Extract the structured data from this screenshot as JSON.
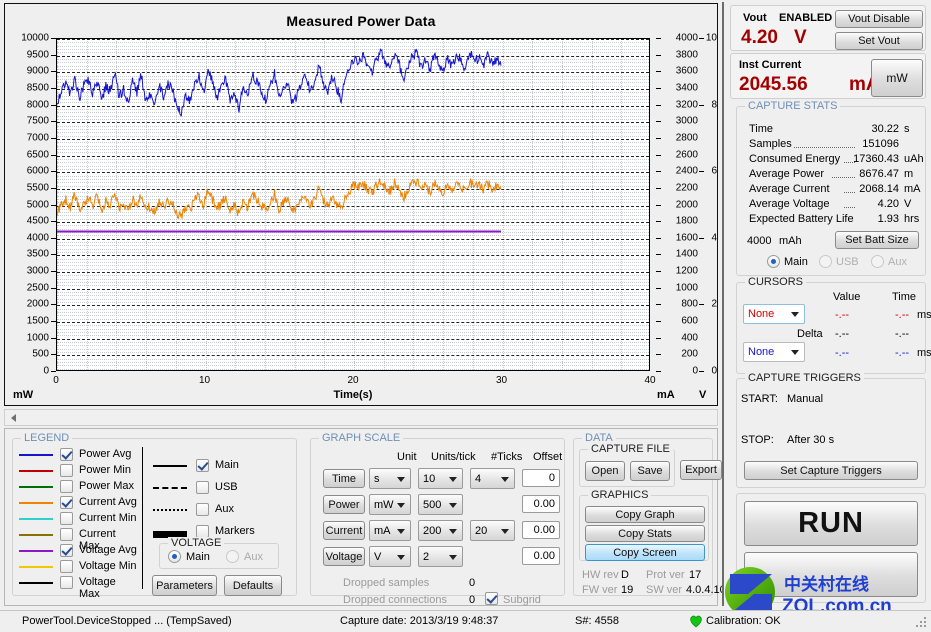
{
  "chart_data": {
    "type": "line",
    "title": "Measured Power Data",
    "xlabel": "Time(s)",
    "xlim": [
      0,
      40
    ],
    "xticks": [
      0,
      10,
      20,
      30,
      40
    ],
    "grid": true,
    "subgrid": true,
    "axes": [
      {
        "name": "Power",
        "unit": "mW",
        "side": "left",
        "lim": [
          0,
          10000
        ],
        "tick_step": 500,
        "ticks": [
          0,
          500,
          1000,
          1500,
          2000,
          2500,
          3000,
          3500,
          4000,
          4500,
          5000,
          5500,
          6000,
          6500,
          7000,
          7500,
          8000,
          8500,
          9000,
          9500,
          10000
        ]
      },
      {
        "name": "Current",
        "unit": "mA",
        "side": "right",
        "lim": [
          0,
          4000
        ],
        "tick_step": 200,
        "ticks": [
          0,
          200,
          400,
          600,
          800,
          1000,
          1200,
          1400,
          1600,
          1800,
          2000,
          2200,
          2400,
          2600,
          2800,
          3000,
          3200,
          3400,
          3600,
          3800,
          4000
        ]
      },
      {
        "name": "Voltage",
        "unit": "V",
        "side": "right2",
        "lim": [
          0,
          10
        ],
        "tick_step": 2,
        "ticks": [
          0,
          2,
          4,
          6,
          8,
          10
        ]
      }
    ],
    "series": [
      {
        "name": "Power Avg",
        "color": "#1515cf",
        "axis": "Power",
        "unit": "mW",
        "x": [
          0.0,
          0.3,
          0.6,
          0.9,
          1.2,
          1.5,
          1.8,
          2.1,
          2.4,
          2.7,
          3.0,
          3.3,
          3.6,
          3.9,
          4.2,
          4.5,
          4.8,
          5.1,
          5.4,
          5.7,
          6.0,
          6.3,
          6.6,
          6.9,
          7.2,
          7.5,
          7.8,
          8.1,
          8.4,
          8.7,
          9.0,
          9.3,
          9.6,
          9.9,
          10.2,
          10.5,
          10.8,
          11.1,
          11.4,
          11.7,
          12.0,
          12.3,
          12.6,
          12.9,
          13.2,
          13.5,
          13.8,
          14.1,
          14.4,
          14.7,
          15.0,
          15.3,
          15.6,
          15.9,
          16.2,
          16.5,
          16.8,
          17.1,
          17.4,
          17.7,
          18.0,
          18.3,
          18.6,
          18.9,
          19.2,
          19.5,
          19.8,
          20.1,
          20.4,
          20.7,
          21.0,
          21.3,
          21.6,
          21.9,
          22.2,
          22.5,
          22.8,
          23.1,
          23.4,
          23.7,
          24.0,
          24.3,
          24.6,
          24.9,
          25.2,
          25.5,
          25.8,
          26.1,
          26.4,
          26.7,
          27.0,
          27.3,
          27.6,
          27.9,
          28.2,
          28.5,
          28.8,
          29.1,
          29.4,
          29.7,
          30.0
        ],
        "y": [
          8000,
          8450,
          8700,
          8300,
          8900,
          8200,
          8550,
          8750,
          8350,
          8800,
          8150,
          8600,
          8400,
          9000,
          8250,
          8500,
          8050,
          8700,
          8400,
          8900,
          8100,
          8350,
          7950,
          8600,
          8250,
          8700,
          8450,
          8000,
          7800,
          8300,
          8150,
          8600,
          8900,
          8400,
          9100,
          8700,
          8250,
          8500,
          8800,
          8100,
          8350,
          7900,
          8600,
          8250,
          9000,
          8700,
          8400,
          8150,
          8550,
          8950,
          8200,
          8500,
          8750,
          8050,
          8300,
          8650,
          8900,
          8450,
          8700,
          9200,
          8600,
          8300,
          8900,
          8500,
          8200,
          8850,
          9150,
          9400,
          9300,
          9500,
          9200,
          9000,
          9400,
          9600,
          9250,
          9100,
          9500,
          9300,
          8700,
          9200,
          9450,
          9600,
          9150,
          9350,
          9050,
          9550,
          9250,
          9000,
          9400,
          9200,
          9550,
          9350,
          9100,
          9600,
          9300,
          9450,
          9150,
          9500,
          9250,
          9400,
          9200
        ]
      },
      {
        "name": "Current Avg",
        "color": "#ef8200",
        "axis": "Current",
        "unit": "mA",
        "x": [
          0.0,
          0.3,
          0.6,
          0.9,
          1.2,
          1.5,
          1.8,
          2.1,
          2.4,
          2.7,
          3.0,
          3.3,
          3.6,
          3.9,
          4.2,
          4.5,
          4.8,
          5.1,
          5.4,
          5.7,
          6.0,
          6.3,
          6.6,
          6.9,
          7.2,
          7.5,
          7.8,
          8.1,
          8.4,
          8.7,
          9.0,
          9.3,
          9.6,
          9.9,
          10.2,
          10.5,
          10.8,
          11.1,
          11.4,
          11.7,
          12.0,
          12.3,
          12.6,
          12.9,
          13.2,
          13.5,
          13.8,
          14.1,
          14.4,
          14.7,
          15.0,
          15.3,
          15.6,
          15.9,
          16.2,
          16.5,
          16.8,
          17.1,
          17.4,
          17.7,
          18.0,
          18.3,
          18.6,
          18.9,
          19.2,
          19.5,
          19.8,
          20.1,
          20.4,
          20.7,
          21.0,
          21.3,
          21.6,
          21.9,
          22.2,
          22.5,
          22.8,
          23.1,
          23.4,
          23.7,
          24.0,
          24.3,
          24.6,
          24.9,
          25.2,
          25.5,
          25.8,
          26.1,
          26.4,
          26.7,
          27.0,
          27.3,
          27.6,
          27.9,
          28.2,
          28.5,
          28.8,
          29.1,
          29.4,
          29.7,
          30.0
        ],
        "y": [
          1900,
          2010,
          2070,
          1980,
          2120,
          1960,
          2030,
          2080,
          1990,
          2100,
          1940,
          2050,
          2000,
          2140,
          1970,
          2020,
          1910,
          2070,
          2000,
          2120,
          1930,
          1990,
          1890,
          2050,
          1970,
          2070,
          2010,
          1900,
          1860,
          1980,
          1940,
          2050,
          2120,
          2000,
          2170,
          2070,
          1970,
          2020,
          2100,
          1930,
          1990,
          1880,
          2050,
          1970,
          2140,
          2070,
          2000,
          1940,
          2030,
          2130,
          1950,
          2020,
          2080,
          1910,
          1980,
          2060,
          2120,
          2010,
          2070,
          2190,
          2050,
          1980,
          2120,
          2020,
          1950,
          2110,
          2180,
          2240,
          2210,
          2260,
          2190,
          2150,
          2240,
          2290,
          2200,
          2170,
          2260,
          2220,
          2070,
          2190,
          2250,
          2290,
          2180,
          2230,
          2160,
          2270,
          2200,
          2140,
          2240,
          2190,
          2270,
          2230,
          2170,
          2290,
          2210,
          2250,
          2180,
          2260,
          2200,
          2240,
          2190
        ]
      },
      {
        "name": "Voltage Avg",
        "color": "#8b18c9",
        "axis": "Voltage",
        "unit": "V",
        "x": [
          0,
          30
        ],
        "y": [
          4.2,
          4.2
        ]
      }
    ]
  },
  "legend": {
    "title": "LEGEND",
    "items": [
      {
        "label": "Power Avg",
        "color": "#1515cf",
        "checked": true
      },
      {
        "label": "Power Min",
        "color": "#c00000",
        "checked": false
      },
      {
        "label": "Power Max",
        "color": "#007000",
        "checked": false
      },
      {
        "label": "Current Avg",
        "color": "#ef8200",
        "checked": true
      },
      {
        "label": "Current Min",
        "color": "#2bd0d0",
        "checked": false
      },
      {
        "label": "Current Max",
        "color": "#8a7000",
        "checked": false
      },
      {
        "label": "Voltage Avg",
        "color": "#8b18c9",
        "checked": true
      },
      {
        "label": "Voltage Min",
        "color": "#f2c600",
        "checked": false
      },
      {
        "label": "Voltage Max",
        "color": "#000000",
        "checked": false
      }
    ],
    "channels": [
      {
        "label": "Main",
        "style": "solid",
        "checked": true
      },
      {
        "label": "USB",
        "style": "dashed",
        "checked": false
      },
      {
        "label": "Aux",
        "style": "dotted",
        "checked": false
      },
      {
        "label": "Markers",
        "style": "thick",
        "checked": false
      }
    ],
    "voltage_group": {
      "title": "VOLTAGE",
      "options": [
        {
          "label": "Main",
          "selected": true,
          "enabled": true
        },
        {
          "label": "Aux",
          "selected": false,
          "enabled": false
        }
      ]
    },
    "parameters_button": "Parameters",
    "defaults_button": "Defaults"
  },
  "graph_scale": {
    "title": "GRAPH SCALE",
    "headers": {
      "unit": "Unit",
      "units_per_tick": "Units/tick",
      "ticks": "#Ticks",
      "offset": "Offset"
    },
    "rows": [
      {
        "name": "Time",
        "unit": "s",
        "units_per_tick": "10",
        "ticks": "4",
        "offset": "0",
        "has_ticks": true
      },
      {
        "name": "Power",
        "unit": "mW",
        "units_per_tick": "500",
        "ticks": "",
        "offset": "0.00",
        "has_ticks": false
      },
      {
        "name": "Current",
        "unit": "mA",
        "units_per_tick": "200",
        "ticks": "20",
        "offset": "0.00",
        "has_ticks": true
      },
      {
        "name": "Voltage",
        "unit": "V",
        "units_per_tick": "2",
        "ticks": "",
        "offset": "0.00",
        "has_ticks": false
      }
    ],
    "dropped_samples_label": "Dropped samples",
    "dropped_samples_value": "0",
    "dropped_connections_label": "Dropped connections",
    "dropped_connections_value": "0",
    "subgrid_label": "Subgrid",
    "subgrid_checked": true
  },
  "data_panel": {
    "title": "DATA",
    "capture_file_title": "CAPTURE FILE",
    "open_button": "Open",
    "save_button": "Save",
    "export_button": "Export",
    "graphics_title": "GRAPHICS",
    "copy_graph_button": "Copy Graph",
    "copy_stats_button": "Copy Stats",
    "copy_screen_button": "Copy Screen",
    "hw_rev_label": "HW rev",
    "hw_rev_value": "D",
    "prot_ver_label": "Prot ver",
    "prot_ver_value": "17",
    "fw_ver_label": "FW ver",
    "fw_ver_value": "19",
    "sw_ver_label": "SW ver",
    "sw_ver_value": "4.0.4.10"
  },
  "vout": {
    "label": "Vout",
    "state": "ENABLED",
    "value": "4.20",
    "unit": "V",
    "disable_button": "Vout Disable",
    "set_button": "Set Vout"
  },
  "inst_current": {
    "label": "Inst Current",
    "value": "2045.56",
    "unit": "mA",
    "mode_button": "mW"
  },
  "capture_stats": {
    "title": "CAPTURE STATS",
    "rows": [
      {
        "label": "Time",
        "value": "30.22",
        "unit": "s",
        "leader": false
      },
      {
        "label": "Samples",
        "value": "151096",
        "unit": "",
        "leader": true
      },
      {
        "label": "Consumed Energy",
        "value": "17360.43",
        "unit": "uAh",
        "leader": true
      },
      {
        "label": "Average Power",
        "value": "8676.47",
        "unit": "m",
        "leader": true
      },
      {
        "label": "Average Current",
        "value": "2068.14",
        "unit": "mA",
        "leader": true
      },
      {
        "label": "Average Voltage",
        "value": "4.20",
        "unit": "V",
        "leader": true
      },
      {
        "label": "Expected Battery Life",
        "value": "1.93",
        "unit": "hrs",
        "leader": false
      }
    ],
    "batt_size_value": "4000",
    "batt_size_unit": "mAh",
    "set_batt_button": "Set Batt Size",
    "sources": [
      {
        "label": "Main",
        "selected": true,
        "enabled": true
      },
      {
        "label": "USB",
        "selected": false,
        "enabled": false
      },
      {
        "label": "Aux",
        "selected": false,
        "enabled": false
      }
    ]
  },
  "cursors": {
    "title": "CURSORS",
    "value_header": "Value",
    "time_header": "Time",
    "cursor1": {
      "select": "None",
      "value": "-.--",
      "time": "-.--",
      "time_unit": "ms",
      "color": "#d00000"
    },
    "delta": {
      "label": "Delta",
      "value": "-.--",
      "time": "-.--"
    },
    "cursor2": {
      "select": "None",
      "value": "-.--",
      "time": "-.--",
      "time_unit": "ms",
      "color": "#1515cf"
    }
  },
  "capture_triggers": {
    "title": "CAPTURE TRIGGERS",
    "start_label": "START:",
    "start_value": "Manual",
    "stop_label": "STOP:",
    "stop_value": "After 30 s",
    "set_button": "Set Capture Triggers"
  },
  "run": {
    "label": "RUN"
  },
  "watermark": {
    "cn": "中关村在线",
    "en": "ZOL.com.cn"
  },
  "statusbar": {
    "device_state": "PowerTool.DeviceStopped ... (TempSaved)",
    "capture_date": "Capture date: 2013/3/19 9:48:37",
    "serial": "S#: 4558",
    "calibration": "Calibration: OK"
  }
}
